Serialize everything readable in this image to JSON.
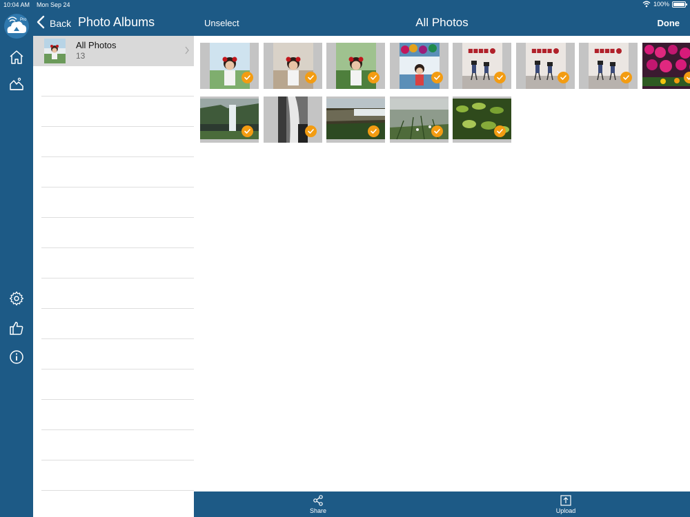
{
  "status": {
    "time": "10:04 AM",
    "date": "Mon Sep 24",
    "battery": "100%"
  },
  "rail": {
    "logo_badge": "Pro",
    "icons": [
      "home-icon",
      "gallery-icon",
      "settings-icon",
      "like-icon",
      "info-icon"
    ]
  },
  "albums": {
    "back_label": "Back",
    "title": "Photo Albums",
    "items": [
      {
        "name": "All Photos",
        "count": "13"
      }
    ]
  },
  "main": {
    "unselect_label": "Unselect",
    "title": "All Photos",
    "done_label": "Done",
    "photos": [
      {
        "kind": "portrait-girl",
        "selected": true
      },
      {
        "kind": "portrait-girl-castle",
        "selected": true
      },
      {
        "kind": "portrait-girl-trees",
        "selected": true
      },
      {
        "kind": "portrait-girl-flowers",
        "selected": true
      },
      {
        "kind": "kids-sign-wall",
        "selected": true
      },
      {
        "kind": "kids-sign-wall-2",
        "selected": true
      },
      {
        "kind": "kids-sign-wall-3",
        "selected": true
      },
      {
        "kind": "pink-flowers",
        "selected": true
      },
      {
        "kind": "waterfall",
        "selected": true
      },
      {
        "kind": "waterfall-bw",
        "selected": true
      },
      {
        "kind": "waterfall-cliff",
        "selected": true
      },
      {
        "kind": "grass-field",
        "selected": true
      },
      {
        "kind": "green-leaves",
        "selected": true
      }
    ]
  },
  "bottombar": {
    "share_label": "Share",
    "upload_label": "Upload"
  },
  "colors": {
    "bar": "#1d5a86",
    "check": "#f39c12",
    "selected_row": "#d9d9d9"
  }
}
